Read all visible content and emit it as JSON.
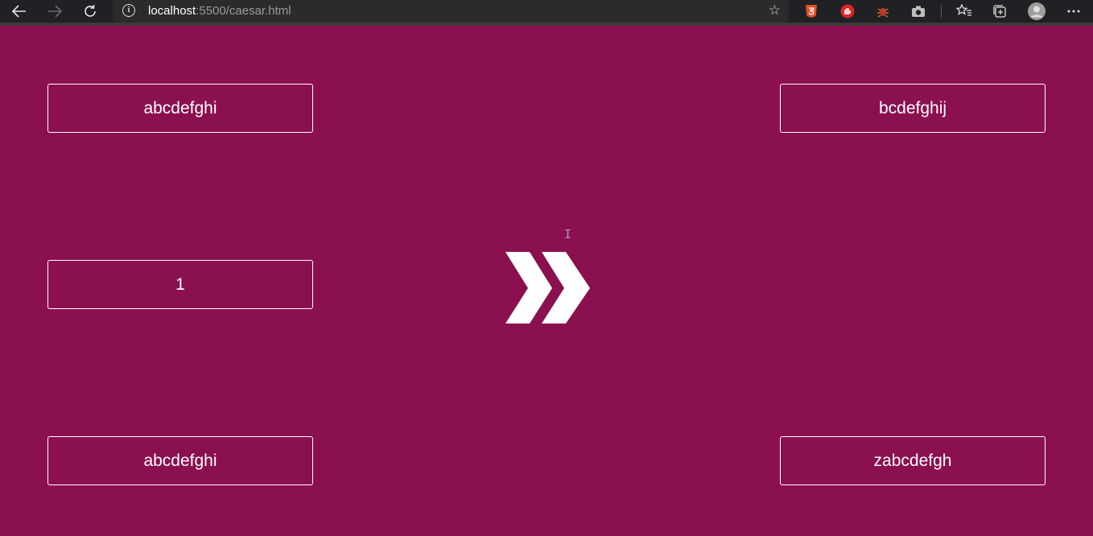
{
  "browser": {
    "url_host": "localhost",
    "url_rest": ":5500/caesar.html",
    "nav_icons": [
      "back-arrow-icon",
      "forward-arrow-icon",
      "refresh-icon"
    ],
    "extension_icons": [
      "html5-extension-icon",
      "adblock-extension-icon",
      "bug-extension-icon",
      "camera-extension-icon"
    ],
    "toolbar_icons": [
      "favorites-icon",
      "collections-icon",
      "profile-icon",
      "more-icon"
    ]
  },
  "page": {
    "background_color": "#8b104f",
    "plain_text_top": "abcdefghi",
    "cipher_text_top": "bcdefghij",
    "shift_value": "1",
    "plain_text_bottom": "abcdefghi",
    "cipher_text_bottom": "zabcdefgh",
    "arrow_icon": "double-chevron-right-icon"
  }
}
